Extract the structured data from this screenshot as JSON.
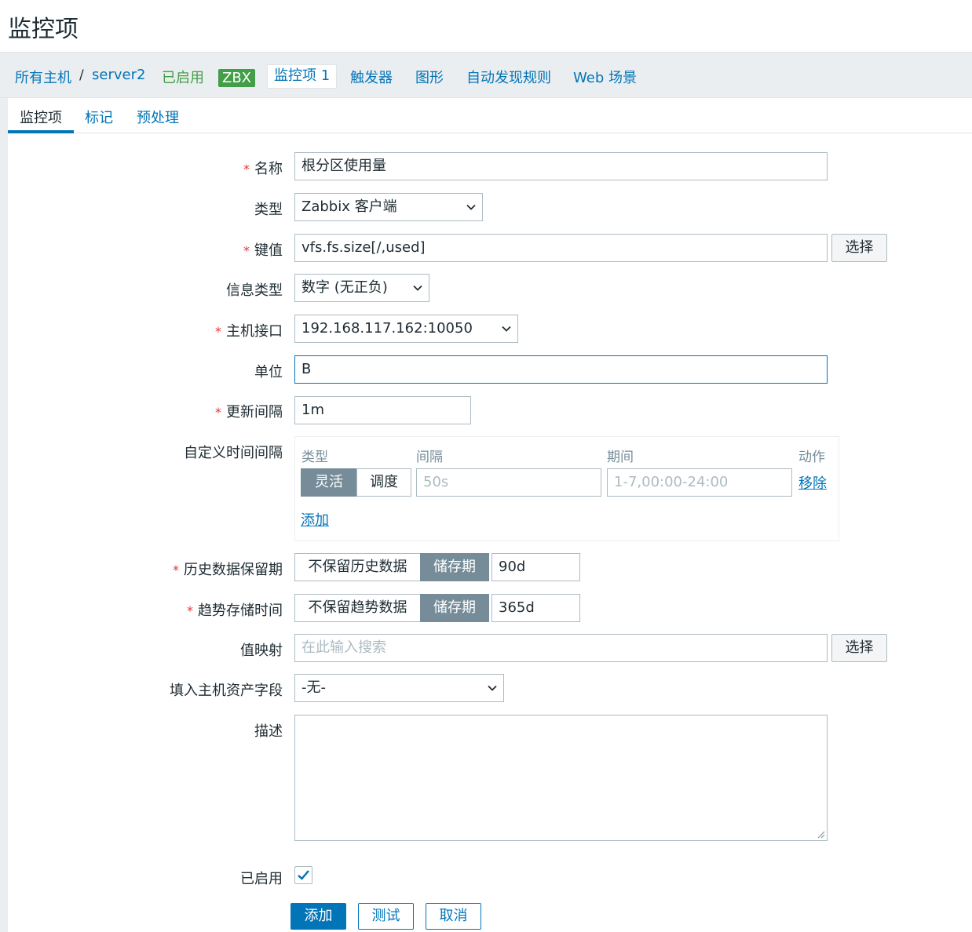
{
  "page": {
    "title": "监控项"
  },
  "host_nav": {
    "all_hosts": "所有主机",
    "separator": "/",
    "host": "server2",
    "status": "已启用",
    "zbx_badge": "ZBX",
    "items_tab": "监控项 1",
    "triggers": "触发器",
    "graphs": "图形",
    "discovery": "自动发现规则",
    "web": "Web 场景"
  },
  "form_tabs": {
    "item": "监控项",
    "tags": "标记",
    "preprocessing": "预处理"
  },
  "required_mark": "*",
  "fields": {
    "name": {
      "label": "名称",
      "value": "根分区使用量"
    },
    "type": {
      "label": "类型",
      "value": "Zabbix 客户端"
    },
    "key": {
      "label": "键值",
      "value": "vfs.fs.size[/,used]",
      "button": "选择"
    },
    "value_type": {
      "label": "信息类型",
      "value": "数字 (无正负)"
    },
    "interface": {
      "label": "主机接口",
      "value": "192.168.117.162:10050"
    },
    "units": {
      "label": "单位",
      "value": "B"
    },
    "delay": {
      "label": "更新间隔",
      "value": "1m"
    },
    "custom_intervals": {
      "label": "自定义时间间隔",
      "col_type": "类型",
      "col_interval": "间隔",
      "col_period": "期间",
      "col_action": "动作",
      "flexible": "灵活",
      "scheduling": "调度",
      "interval_placeholder": "50s",
      "period_placeholder": "1-7,00:00-24:00",
      "remove": "移除",
      "add": "添加"
    },
    "history": {
      "label": "历史数据保留期",
      "off": "不保留历史数据",
      "on": "储存期",
      "value": "90d"
    },
    "trends": {
      "label": "趋势存储时间",
      "off": "不保留趋势数据",
      "on": "储存期",
      "value": "365d"
    },
    "valuemap": {
      "label": "值映射",
      "placeholder": "在此输入搜索",
      "button": "选择"
    },
    "inventory": {
      "label": "填入主机资产字段",
      "value": "-无-"
    },
    "description": {
      "label": "描述",
      "value": ""
    },
    "enabled": {
      "label": "已启用",
      "checked": true
    }
  },
  "buttons": {
    "add": "添加",
    "test": "测试",
    "cancel": "取消"
  },
  "colors": {
    "accent": "#0275b8",
    "enabled": "#429e47",
    "required": "#e33734",
    "segment_on": "#768d99"
  }
}
